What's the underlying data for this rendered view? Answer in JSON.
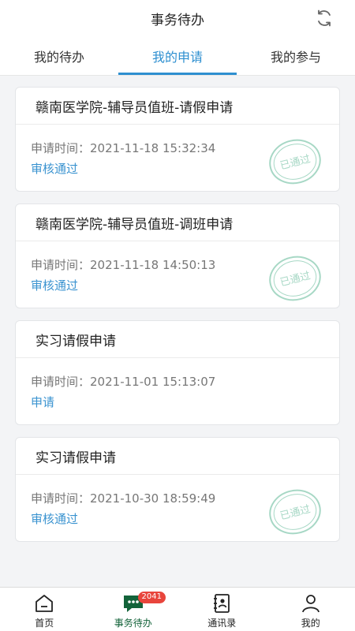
{
  "header": {
    "title": "事务待办"
  },
  "tabs": [
    {
      "label": "我的待办",
      "active": false
    },
    {
      "label": "我的申请",
      "active": true
    },
    {
      "label": "我的参与",
      "active": false
    }
  ],
  "stamp_text": "已通过",
  "cards": [
    {
      "title": "赣南医学院-辅导员值班-请假申请",
      "time_label": "申请时间：",
      "time": "2021-11-18 15:32:34",
      "status": "审核通过",
      "stamped": true
    },
    {
      "title": "赣南医学院-辅导员值班-调班申请",
      "time_label": "申请时间：",
      "time": "2021-11-18 14:50:13",
      "status": "审核通过",
      "stamped": true
    },
    {
      "title": "实习请假申请",
      "time_label": "申请时间：",
      "time": "2021-11-01 15:13:07",
      "status": "申请",
      "stamped": false
    },
    {
      "title": "实习请假申请",
      "time_label": "申请时间：",
      "time": "2021-10-30 18:59:49",
      "status": "审核通过",
      "stamped": true
    }
  ],
  "bottom_nav": [
    {
      "label": "首页",
      "icon": "home-icon"
    },
    {
      "label": "事务待办",
      "icon": "chat-icon",
      "badge": "2041",
      "active": true
    },
    {
      "label": "通讯录",
      "icon": "contacts-icon"
    },
    {
      "label": "我的",
      "icon": "user-icon"
    }
  ],
  "colors": {
    "accent": "#2e8fd0",
    "status": "#3a93d0",
    "stamp": "#5fb896",
    "nav_active": "#13633a",
    "badge": "#e8453c"
  }
}
